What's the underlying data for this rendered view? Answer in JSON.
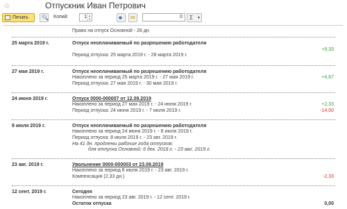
{
  "title": "Отпускник Иван Петрович",
  "toolbar": {
    "print_label": "Печать",
    "copies_label": "Копий:",
    "copies_value": "1",
    "number_value": "0",
    "sum_symbol": "Σ"
  },
  "report": {
    "intro": "Право на отпуск Основной - 28 дн.",
    "e1": {
      "date": "25 марта 2019 г.",
      "heading": "Отпуск неоплачиваемый по разрешению работодателя",
      "period": "Период отпуска: 25 марта 2019 г. - 28 марта 2019 г.",
      "value": "+9,33"
    },
    "e2": {
      "date": "27 мая 2019 г.",
      "heading": "Отпуск неоплачиваемый по разрешению работодателя",
      "accrued": "Накоплено за период 25 марта 2019 г. - 27 мая 2019 г.",
      "period": "Период отпуска: 27 мая 2019 г. - 30 мая 2019 г.",
      "value": "+4,67"
    },
    "e3": {
      "date": "24 июня 2019 г.",
      "heading": "Отпуск 0000-000007 от 12.09.2019",
      "accrued": "Накоплено за период 27 мая 2019 г. - 24 июня 2019 г.",
      "period": "Период отпуска: 24 июня 2019 г. - 7 июля 2019 г.",
      "accrued_value": "+2,33",
      "period_value": "-14,00"
    },
    "e4": {
      "date": "8 июля 2019 г.",
      "heading": "Отпуск неоплачиваемый по разрешению работодателя",
      "accrued": "Накоплено за период 24 июня 2019 г. - 8 июля 2019 г.",
      "period": "Период отпуска: 8 июля 2019 г. - 23 авг. 2019 г.",
      "note1": "На 41 дн. продлены рабочие года отпусков:",
      "note2": "для отпуска Основной: 6 дек. 2018 г. - 23 авг. 2019 г."
    },
    "e5": {
      "date": "23 авг. 2019 г.",
      "heading": "Увольнение 0000-000003 от 23.08.2019",
      "accrued": "Накоплено за период 8 июля 2019 г. - 23 авг. 2019 г.",
      "compensation": "Компенсация (2,33 дн.)",
      "value": "-2,33"
    },
    "e6": {
      "date": "12 сент. 2019 г.",
      "heading": "Сегодня",
      "accrued": "Накоплено за период 23 авг. 2019 г. - 12 сент. 2019 г.",
      "balance": "Остаток отпуска",
      "balance_value": "0,00"
    }
  }
}
